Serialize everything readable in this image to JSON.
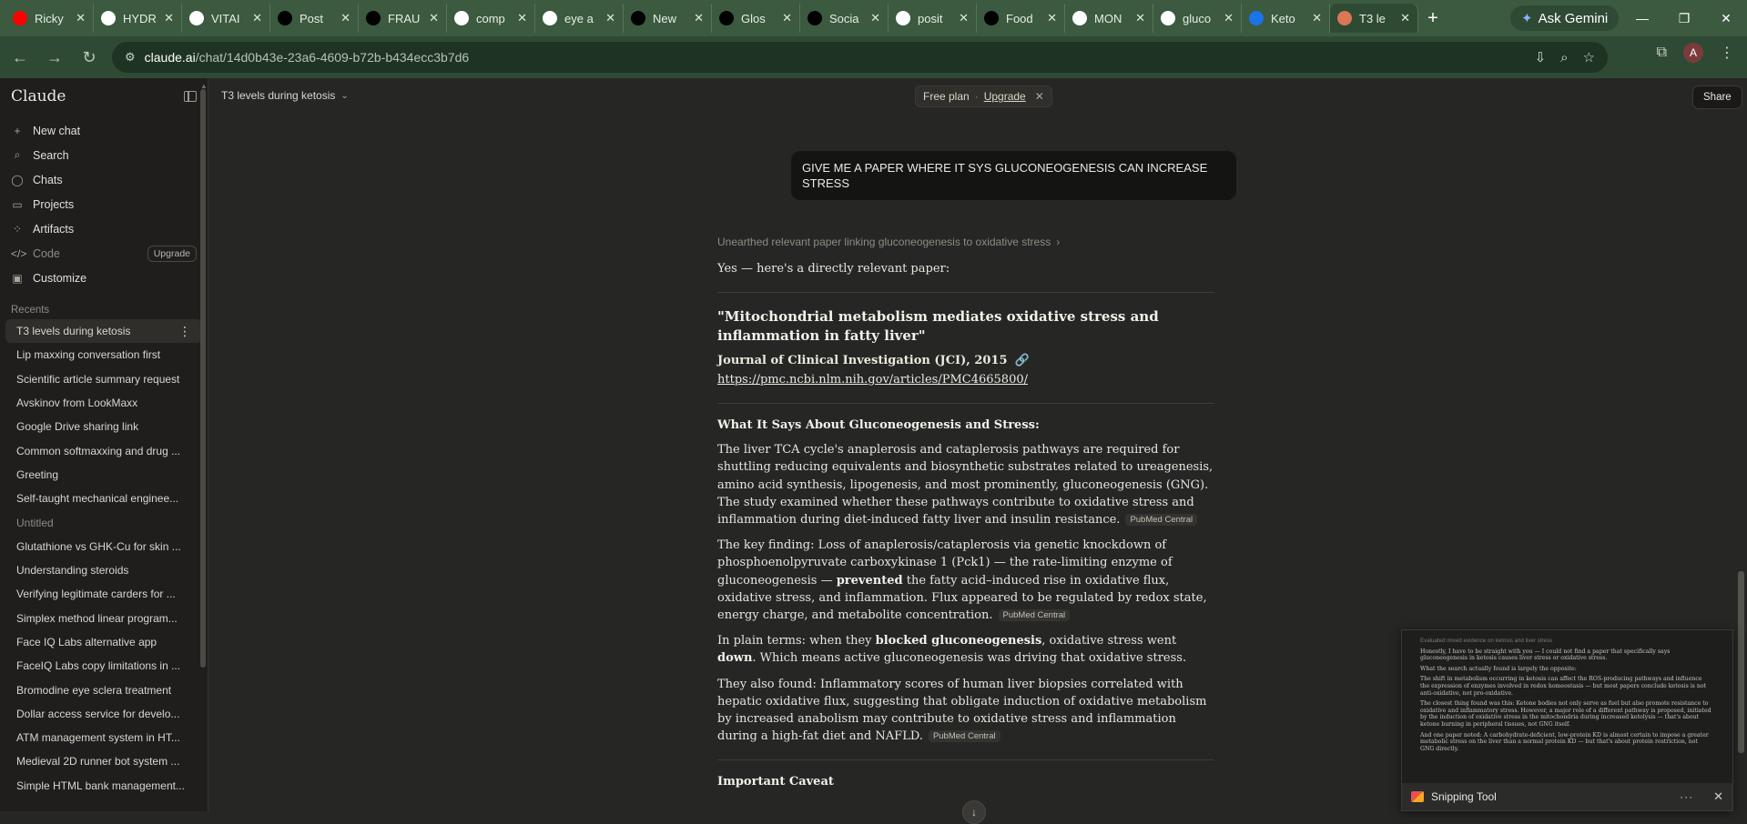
{
  "browser": {
    "tabs": [
      {
        "label": "Ricky",
        "icon": "youtube-icon",
        "color": "#ff0000"
      },
      {
        "label": "HYDR",
        "icon": "google-icon",
        "color": "#ffffff"
      },
      {
        "label": "VITAI",
        "icon": "google-icon",
        "color": "#ffffff"
      },
      {
        "label": "Post",
        "icon": "meta-icon",
        "color": "#000000"
      },
      {
        "label": "FRAU",
        "icon": "meta-icon",
        "color": "#000000"
      },
      {
        "label": "comp",
        "icon": "google-icon",
        "color": "#ffffff"
      },
      {
        "label": "eye a",
        "icon": "google-icon",
        "color": "#ffffff"
      },
      {
        "label": "New",
        "icon": "openai-icon",
        "color": "#000000"
      },
      {
        "label": "Glos",
        "icon": "meta-icon",
        "color": "#000000"
      },
      {
        "label": "Socia",
        "icon": "meta-icon",
        "color": "#000000"
      },
      {
        "label": "posit",
        "icon": "google-icon",
        "color": "#ffffff"
      },
      {
        "label": "Food",
        "icon": "meta-icon",
        "color": "#000000"
      },
      {
        "label": "MON",
        "icon": "google-icon",
        "color": "#ffffff"
      },
      {
        "label": "gluco",
        "icon": "google-icon",
        "color": "#ffffff"
      },
      {
        "label": "Keto",
        "icon": "perplexity-icon",
        "color": "#1a73e8"
      },
      {
        "label": "T3 le",
        "icon": "claude-icon",
        "color": "#d97757",
        "active": true
      }
    ],
    "ask_gemini": "Ask Gemini",
    "url_host": "claude.ai",
    "url_path": "/chat/14d0b43e-23a6-4609-b72b-b434ecc3b7d6",
    "profile_initial": "A"
  },
  "sidebar": {
    "logo": "Claude",
    "nav": [
      {
        "label": "New chat",
        "icon": "+"
      },
      {
        "label": "Search",
        "icon": "⌕"
      },
      {
        "label": "Chats",
        "icon": "◯"
      },
      {
        "label": "Projects",
        "icon": "▭"
      },
      {
        "label": "Artifacts",
        "icon": "⁘"
      },
      {
        "label": "Code",
        "icon": "</>",
        "badge": "Upgrade"
      },
      {
        "label": "Customize",
        "icon": "▣"
      }
    ],
    "recents_heading": "Recents",
    "recents": [
      "T3 levels during ketosis",
      "Lip maxxing conversation first",
      "Scientific article summary request",
      "Avskinov from LookMaxx",
      "Google Drive sharing link",
      "Common softmaxxing and drug ...",
      "Greeting",
      "Self-taught mechanical enginee...",
      "Untitled",
      "Glutathione vs GHK-Cu for skin ...",
      "Understanding steroids",
      "Verifying legitimate carders for ...",
      "Simplex method linear program...",
      "Face IQ Labs alternative app",
      "FaceIQ Labs copy limitations in ...",
      "Bromodine eye sclera treatment",
      "Dollar access service for develo...",
      "ATM management system in HT...",
      "Medieval 2D runner bot system ...",
      "Simple HTML bank management..."
    ]
  },
  "topbar": {
    "conversation_title": "T3 levels during ketosis",
    "free_plan": "Free plan",
    "upgrade": "Upgrade",
    "share": "Share"
  },
  "chat": {
    "user_message": "GIVE ME A PAPER WHERE IT SYS GLUCONEOGENESIS CAN INCREASE STRESS",
    "thinking_summary": "Unearthed relevant paper linking gluconeogenesis to oxidative stress",
    "intro": "Yes — here's a directly relevant paper:",
    "paper_title": "\"Mitochondrial metabolism mediates oxidative stress and inflammation in fatty liver\"",
    "journal": "Journal of Clinical Investigation (JCI), 2015",
    "paper_url": "https://pmc.ncbi.nlm.nih.gov/articles/PMC4665800/",
    "section_heading": "What It Says About Gluconeogenesis and Stress:",
    "p1": "The liver TCA cycle's anaplerosis and cataplerosis pathways are required for shuttling reducing equivalents and biosynthetic substrates related to ureagenesis, amino acid synthesis, lipogenesis, and most prominently, gluconeogenesis (GNG). The study examined whether these pathways contribute to oxidative stress and inflammation during diet-induced fatty liver and insulin resistance.",
    "p2_a": "The key finding: Loss of anaplerosis/cataplerosis via genetic knockdown of phosphoenolpyruvate carboxykinase 1 (Pck1) — the rate-limiting enzyme of gluconeogenesis —",
    "p2_b": "prevented",
    "p2_c": "the fatty acid–induced rise in oxidative flux, oxidative stress, and inflammation. Flux appeared to be regulated by redox state, energy charge, and metabolite concentration.",
    "p3_a": "In plain terms: when they",
    "p3_b": "blocked gluconeogenesis",
    "p3_c": ", oxidative stress went",
    "p3_d": "down",
    "p3_e": ". Which means active gluconeogenesis was driving that oxidative stress.",
    "p4": "They also found: Inflammatory scores of human liver biopsies correlated with hepatic oxidative flux, suggesting that obligate induction of oxidative metabolism by increased anabolism may contribute to oxidative stress and inflammation during a high-fat diet and NAFLD.",
    "cite": "PubMed Central",
    "caveat_heading": "Important Caveat"
  },
  "snipping": {
    "title": "Snipping Tool",
    "preview_head": "Evaluated mixed evidence on ketosis and liver stress",
    "preview_p1": "Honestly, I have to be straight with you — I could not find a paper that specifically says gluconeogenesis in ketosis causes liver stress or oxidative stress.",
    "preview_p2": "What the search actually found is largely the opposite:",
    "preview_p3": "The shift in metabolism occurring in ketosis can affect the ROS-producing pathways and influence the expression of enzymes involved in redox homeostasis — but most papers conclude ketosis is not anti-oxidative, not pro-oxidative.",
    "preview_p4": "The closest thing found was this: Ketone bodies not only serve as fuel but also promote resistance to oxidative and inflammatory stress. However, a major role of a different pathway is proposed, initiated by the induction of oxidative stress in the mitochondria during increased ketolysis — that's about ketone burning in peripheral tissues, not GNG itself.",
    "preview_p5": "And one paper noted: A carbohydrate-deficient, low-protein KD is almost certain to impose a greater metabolic stress on the liver than a normal protein KD — but that's about protein restriction, not GNG directly."
  },
  "colors": {
    "browser_chrome": "#3b5a3f",
    "app_background": "#262624",
    "sidebar_background": "#1f1e1d",
    "user_bubble": "#141413",
    "claude_accent": "#d97757"
  }
}
